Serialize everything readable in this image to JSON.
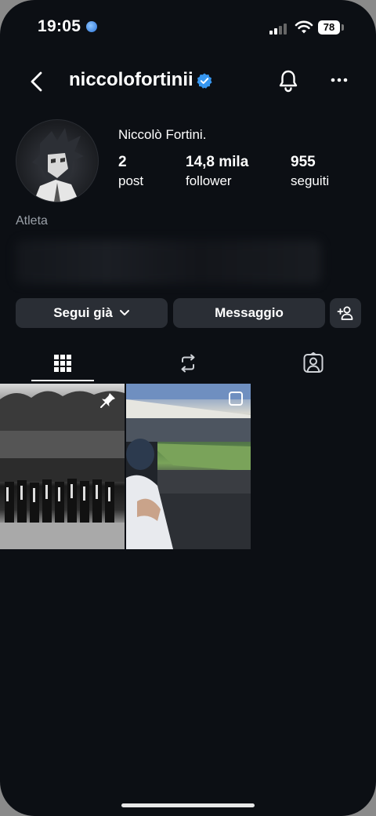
{
  "status_bar": {
    "time": "19:05",
    "battery": "78"
  },
  "header": {
    "username": "niccolofortinii"
  },
  "profile": {
    "display_name": "Niccolò Fortini.",
    "stats": [
      {
        "value": "2",
        "label": "post"
      },
      {
        "value": "14,8 mila",
        "label": "follower"
      },
      {
        "value": "955",
        "label": "seguiti"
      }
    ],
    "category": "Atleta"
  },
  "actions": {
    "follow_label": "Segui già",
    "message_label": "Messaggio"
  },
  "colors": {
    "background": "#0c0f14",
    "button": "#2a2e35",
    "verified": "#3797f0",
    "secondary_text": "#9aa0a8"
  },
  "icons": {
    "tabs": [
      "grid-icon",
      "reels-repost-icon",
      "tagged-icon"
    ]
  }
}
